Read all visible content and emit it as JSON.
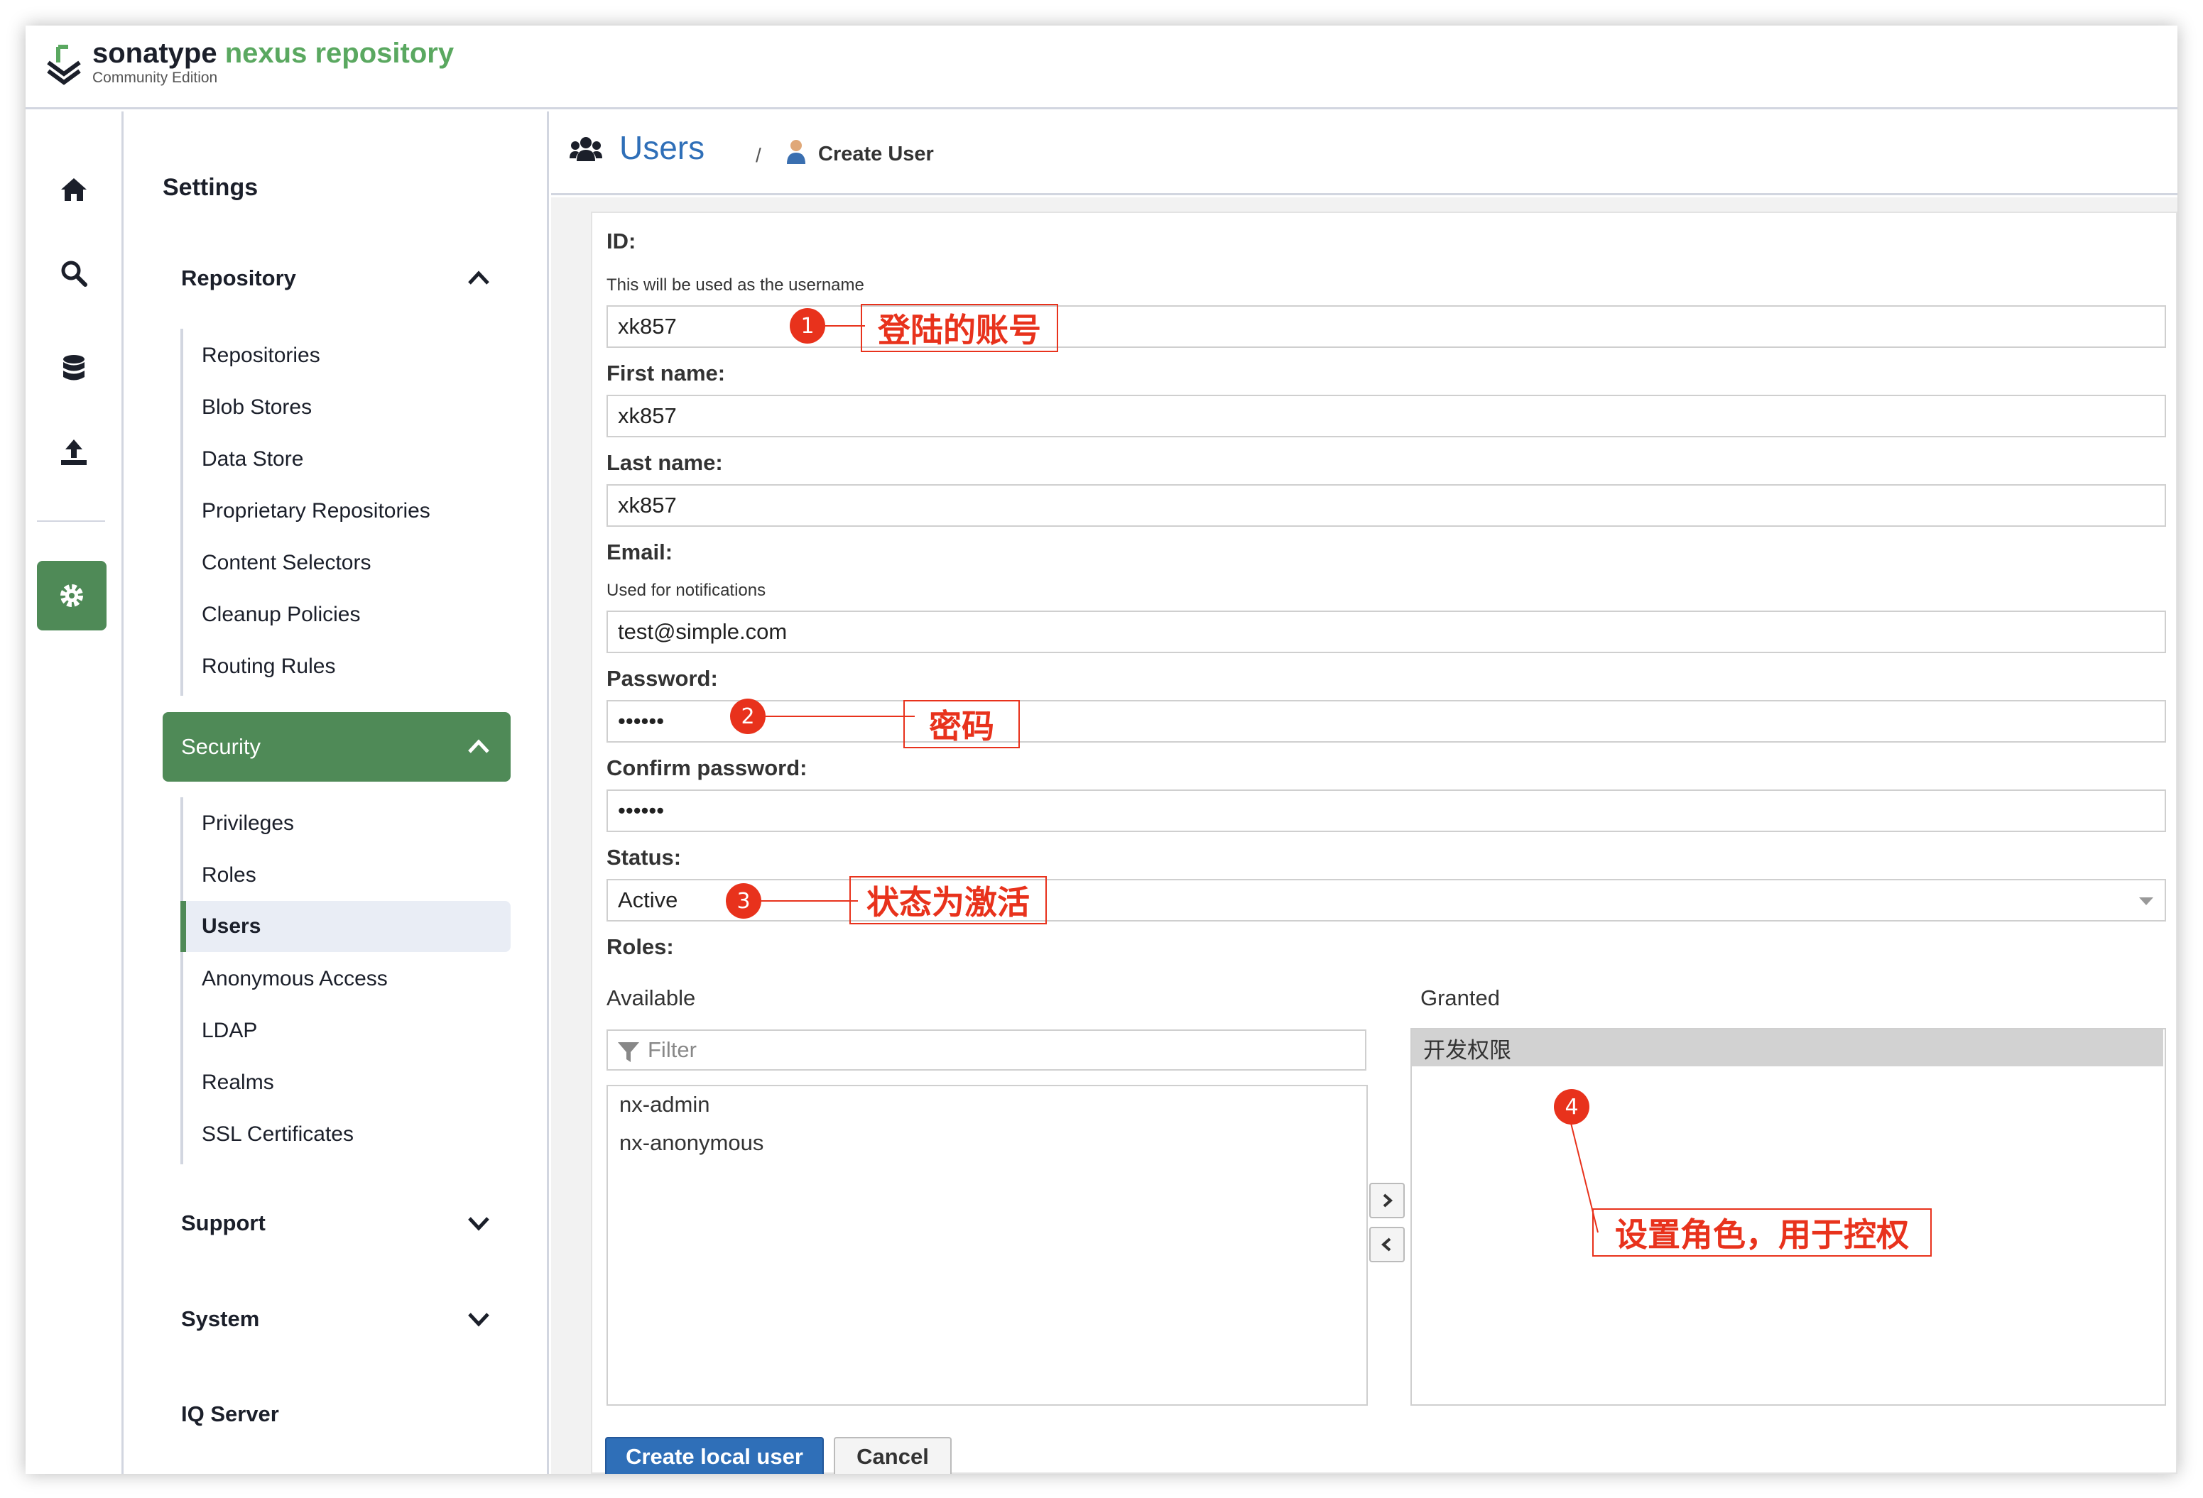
{
  "app": {
    "brand_part1": "sonatype",
    "brand_part2": "nexus repository",
    "edition": "Community Edition"
  },
  "rail": {
    "items": [
      "home-icon",
      "search-icon",
      "database-icon",
      "upload-icon",
      "gear-icon"
    ],
    "accent": "#4f8a57"
  },
  "sidebar": {
    "title": "Settings",
    "groups": {
      "repository": {
        "label": "Repository",
        "items": [
          "Repositories",
          "Blob Stores",
          "Data Store",
          "Proprietary Repositories",
          "Content Selectors",
          "Cleanup Policies",
          "Routing Rules"
        ]
      },
      "security": {
        "label": "Security",
        "items": [
          "Privileges",
          "Roles",
          "Users",
          "Anonymous Access",
          "LDAP",
          "Realms",
          "SSL Certificates"
        ],
        "selected": "Users"
      },
      "support": {
        "label": "Support"
      },
      "system": {
        "label": "System"
      },
      "iq": {
        "label": "IQ Server"
      }
    }
  },
  "header": {
    "section": "Users",
    "separator": "/",
    "page": "Create User"
  },
  "form": {
    "id_label": "ID:",
    "id_hint": "This will be used as the username",
    "id_value": "xk857",
    "first_label": "First name:",
    "first_value": "xk857",
    "last_label": "Last name:",
    "last_value": "xk857",
    "email_label": "Email:",
    "email_hint": "Used for notifications",
    "email_value": "test@simple.com",
    "password_label": "Password:",
    "password_value": "••••••",
    "confirm_label": "Confirm password:",
    "confirm_value": "••••••",
    "status_label": "Status:",
    "status_value": "Active",
    "roles_label": "Roles:",
    "available_label": "Available",
    "filter_placeholder": "Filter",
    "available_items": [
      "nx-admin",
      "nx-anonymous"
    ],
    "granted_label": "Granted",
    "granted_items": [
      "开发权限"
    ],
    "move_right": "›",
    "move_left": "‹",
    "create_button": "Create local user",
    "cancel_button": "Cancel"
  },
  "annotations": {
    "color": "#e8321c",
    "items": [
      {
        "number": "1",
        "text": "登陆的账号"
      },
      {
        "number": "2",
        "text": "密码"
      },
      {
        "number": "3",
        "text": "状态为激活"
      },
      {
        "number": "4",
        "text": "设置角色，用于控权"
      }
    ]
  }
}
